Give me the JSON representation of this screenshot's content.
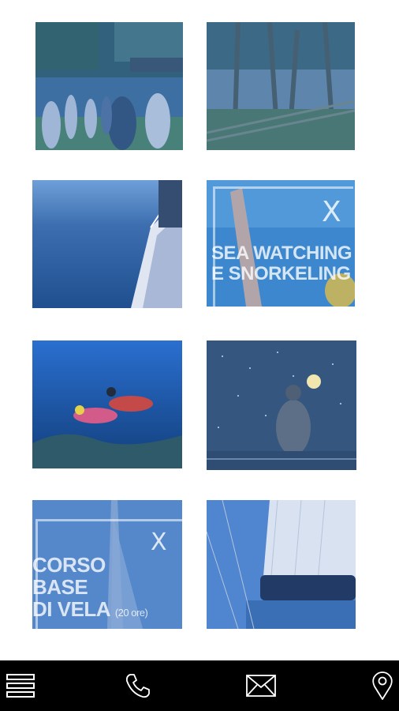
{
  "gallery": {
    "tiles": [
      {
        "id": "group-visit",
        "caption": ""
      },
      {
        "id": "pine-forest-path",
        "caption": ""
      },
      {
        "id": "sailboat-hull",
        "caption": ""
      },
      {
        "id": "sea-watching",
        "caption": "SEA WATCHING\nE SNORKELING",
        "close_symbol": "X"
      },
      {
        "id": "scuba-divers",
        "caption": ""
      },
      {
        "id": "night-sky-moon",
        "caption": ""
      },
      {
        "id": "sailing-course",
        "caption": "CORSO\nBASE\nDI VELA",
        "caption_small": "(20 ore)",
        "close_symbol": "X"
      },
      {
        "id": "sail-rigging",
        "caption": ""
      }
    ]
  },
  "overlay": {
    "sea_line1": "SEA WATCHING",
    "sea_line2": "E SNORKELING",
    "course_line1": "CORSO",
    "course_line2": "BASE",
    "course_line3": "DI VELA",
    "course_hours": "(20 ore)",
    "close_symbol": "X"
  },
  "bottom_bar": {
    "background": "#000000",
    "icons": [
      "menu-icon",
      "phone-icon",
      "mail-icon",
      "location-pin-icon"
    ]
  },
  "colors": {
    "tint": "#3a6fb5",
    "icon": "#ffffff"
  }
}
